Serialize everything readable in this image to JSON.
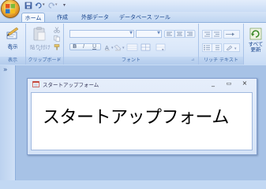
{
  "app": {
    "accent": "#15428b",
    "office_button_icon": "office-orb-icon"
  },
  "quick_access": [
    "save-icon",
    "undo-icon",
    "redo-icon",
    "customize-icon"
  ],
  "tabs": [
    {
      "label": "ホーム",
      "active": true
    },
    {
      "label": "作成",
      "active": false
    },
    {
      "label": "外部データ",
      "active": false
    },
    {
      "label": "データベース ツール",
      "active": false
    }
  ],
  "ribbon": {
    "groups": {
      "views": {
        "label": "表示",
        "view_button": "表示"
      },
      "clipboard": {
        "label": "クリップボード",
        "paste_button": "貼り付け"
      },
      "font": {
        "label": "フォント"
      },
      "rich_text": {
        "label": "リッチ テキスト"
      },
      "records": {
        "refresh_button": "すべて\n更新"
      }
    }
  },
  "nav_pane": {
    "chevron": "»"
  },
  "form_window": {
    "title": "スタートアップフォーム",
    "controls": {
      "minimize": "_",
      "restore": "▭",
      "close": "×"
    },
    "label_text": "スタートアップフォーム"
  }
}
